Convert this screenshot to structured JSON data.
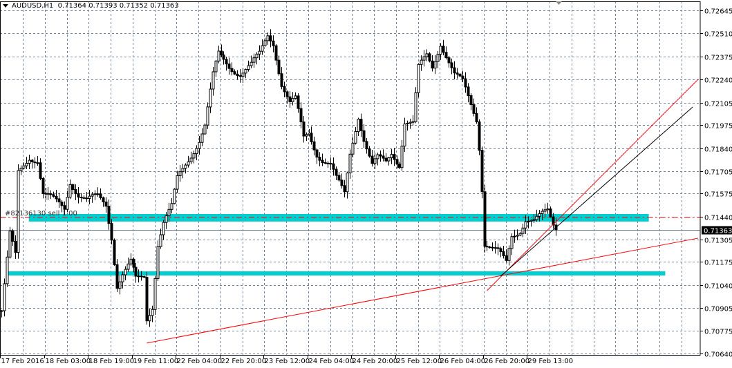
{
  "header": {
    "symbol": "AUDUSD,H1",
    "open": "0.71364",
    "high": "0.71393",
    "low": "0.71352",
    "close": "0.71363"
  },
  "order_label": "#82136130 sell 1.00",
  "colors": {
    "grid": "#70849a",
    "zone": "#00ced1",
    "trendline": "#ff0000",
    "order_line": "#ff0000",
    "bid_line": "#708090",
    "price_tag_bg": "#000000"
  },
  "chart_data": {
    "type": "candlestick",
    "title": "AUDUSD,H1",
    "ylim": [
      0.7064,
      0.72645
    ],
    "y_ticks": [
      "0.72645",
      "0.72510",
      "0.72375",
      "0.72240",
      "0.72105",
      "0.71975",
      "0.71840",
      "0.71705",
      "0.71575",
      "0.71440",
      "0.71305",
      "0.71175",
      "0.71040",
      "0.70905",
      "0.70775",
      "0.70640"
    ],
    "x_ticks": [
      "17 Feb 2016",
      "18 Feb 03:00",
      "18 Feb 19:00",
      "19 Feb 11:00",
      "22 Feb 04:00",
      "22 Feb 20:00",
      "23 Feb 12:00",
      "24 Feb 04:00",
      "24 Feb 20:00",
      "25 Feb 12:00",
      "26 Feb 04:00",
      "26 Feb 20:00",
      "29 Feb 13:00"
    ],
    "bars_per_x_tick": 16,
    "grid": true,
    "current_price": "0.71363",
    "close_path_bar_price": [
      [
        0,
        0.7089
      ],
      [
        3,
        0.71329
      ],
      [
        5,
        0.71207
      ],
      [
        6,
        0.71693
      ],
      [
        10,
        0.71794
      ],
      [
        13,
        0.71774
      ],
      [
        15,
        0.71572
      ],
      [
        19,
        0.71531
      ],
      [
        23,
        0.71491
      ],
      [
        25,
        0.71653
      ],
      [
        28,
        0.71572
      ],
      [
        31,
        0.71531
      ],
      [
        35,
        0.71551
      ],
      [
        38,
        0.71511
      ],
      [
        40,
        0.71329
      ],
      [
        42,
        0.71045
      ],
      [
        44,
        0.71106
      ],
      [
        47,
        0.71167
      ],
      [
        49,
        0.71065
      ],
      [
        52,
        0.71086
      ],
      [
        53,
        0.70843
      ],
      [
        55,
        0.70924
      ],
      [
        57,
        0.71288
      ],
      [
        59,
        0.7141
      ],
      [
        62,
        0.71491
      ],
      [
        64,
        0.71653
      ],
      [
        68,
        0.71774
      ],
      [
        72,
        0.71896
      ],
      [
        74,
        0.71977
      ],
      [
        77,
        0.7226
      ],
      [
        79,
        0.72382
      ],
      [
        83,
        0.72321
      ],
      [
        87,
        0.7228
      ],
      [
        91,
        0.72321
      ],
      [
        94,
        0.72382
      ],
      [
        97,
        0.72503
      ],
      [
        99,
        0.72463
      ],
      [
        102,
        0.7222
      ],
      [
        105,
        0.72098
      ],
      [
        107,
        0.72118
      ],
      [
        110,
        0.71896
      ],
      [
        112,
        0.71936
      ],
      [
        115,
        0.71815
      ],
      [
        117,
        0.71774
      ],
      [
        120,
        0.71734
      ],
      [
        122,
        0.71653
      ],
      [
        125,
        0.71572
      ],
      [
        127,
        0.71815
      ],
      [
        130,
        0.72037
      ],
      [
        132,
        0.71896
      ],
      [
        135,
        0.71734
      ],
      [
        137,
        0.71774
      ],
      [
        140,
        0.71754
      ],
      [
        142,
        0.71815
      ],
      [
        145,
        0.71754
      ],
      [
        147,
        0.71997
      ],
      [
        150,
        0.71977
      ],
      [
        152,
        0.72301
      ],
      [
        155,
        0.72382
      ],
      [
        157,
        0.72321
      ],
      [
        160,
        0.72463
      ],
      [
        162,
        0.72382
      ],
      [
        165,
        0.7226
      ],
      [
        168,
        0.7222
      ],
      [
        170,
        0.72139
      ],
      [
        173,
        0.72017
      ],
      [
        174,
        0.71855
      ],
      [
        175,
        0.71612
      ],
      [
        176,
        0.71288
      ],
      [
        179,
        0.71248
      ],
      [
        181,
        0.71227
      ],
      [
        184,
        0.71167
      ],
      [
        186,
        0.71329
      ],
      [
        189,
        0.71369
      ],
      [
        191,
        0.7143
      ],
      [
        194,
        0.7141
      ],
      [
        196,
        0.7143
      ],
      [
        199,
        0.7147
      ],
      [
        202,
        0.71363
      ]
    ],
    "zones": [
      {
        "name": "resistance-zone",
        "from_bar": 10,
        "to_bar": 236,
        "price_low": 0.71411,
        "price_high": 0.71455
      },
      {
        "name": "support-zone",
        "from_bar": 2,
        "to_bar": 242,
        "price_low": 0.71096,
        "price_high": 0.7112
      }
    ],
    "order_line_price": 0.7144,
    "trendlines": [
      {
        "name": "long-trendline",
        "color": "#ff0000",
        "p1": [
          53,
          0.70701
        ],
        "p2": [
          254,
          0.71314
        ]
      },
      {
        "name": "steep-trendline",
        "color": "#ff0000",
        "p1": [
          177,
          0.71007
        ],
        "p2": [
          254,
          0.72242
        ]
      },
      {
        "name": "black-trendline",
        "color": "#000000",
        "p1": [
          182,
          0.71092
        ],
        "p2": [
          252,
          0.7208
        ]
      }
    ]
  }
}
